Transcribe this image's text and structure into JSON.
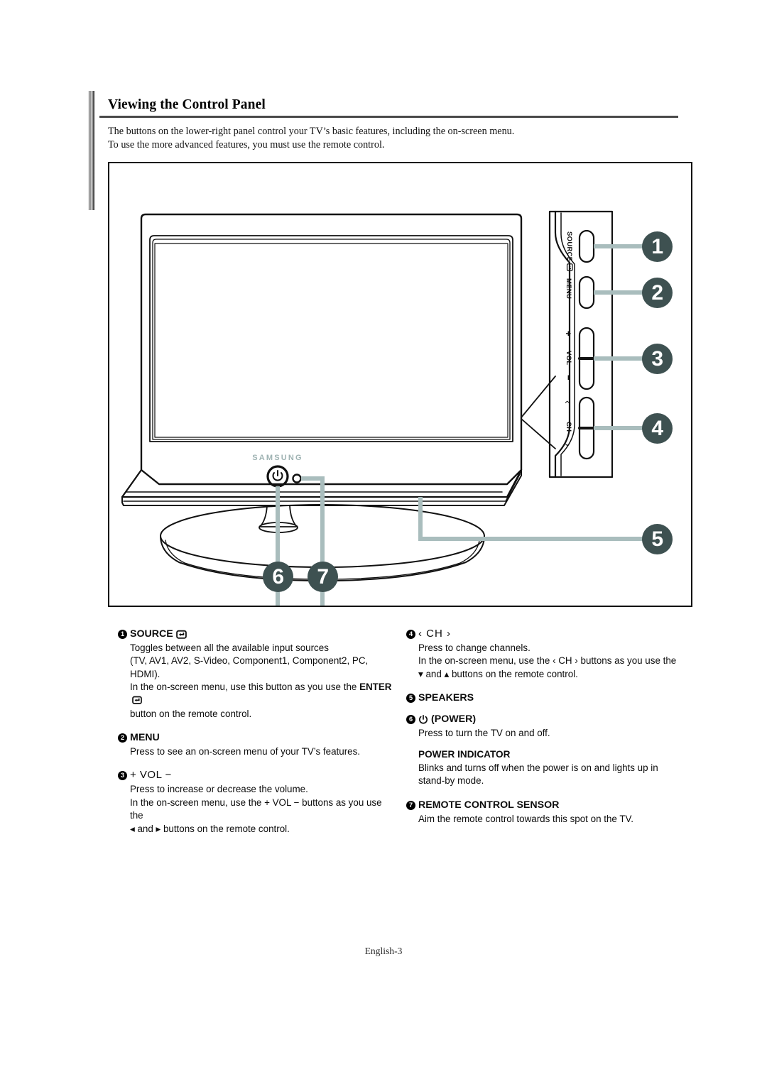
{
  "page": {
    "title": "Viewing the Control Panel",
    "intro_line1": "The buttons on the lower-right panel control your TV’s basic features, including the on-screen menu.",
    "intro_line2": "To use the more advanced features, you must use the remote control.",
    "footer": "English-3"
  },
  "colors": {
    "callout_fill": "#3e5151",
    "callout_text": "#ffffff",
    "leader_line": "#a9bdbd",
    "brand_logo": "#9fb3b3",
    "outline": "#111111"
  },
  "figure": {
    "brand_logo": "SAMSUNG",
    "callouts": [
      {
        "num": "1",
        "target": "source-button"
      },
      {
        "num": "2",
        "target": "menu-button"
      },
      {
        "num": "3",
        "target": "volume-rocker"
      },
      {
        "num": "4",
        "target": "channel-rocker"
      },
      {
        "num": "5",
        "target": "speakers"
      },
      {
        "num": "6",
        "target": "power-button"
      },
      {
        "num": "7",
        "target": "remote-control-sensor"
      }
    ],
    "panel_labels": {
      "source": "SOURCE",
      "menu": "MENU",
      "vol_plus": "+",
      "vol": "VOL",
      "vol_minus": "−",
      "ch_up": "‹",
      "ch": "CH",
      "ch_down": "›"
    }
  },
  "descriptions": {
    "left": [
      {
        "num": "1",
        "title": "SOURCE",
        "icon": "enter-icon",
        "lines": [
          "Toggles between all the available input sources",
          "(TV, AV1, AV2, S-Video, Component1, Component2, PC, HDMI).",
          "In the on-screen menu, use this button as you use the ENTER",
          "button on the remote control."
        ]
      },
      {
        "num": "2",
        "title": "MENU",
        "icon": "",
        "lines": [
          "Press to see an on-screen menu of your TV’s features."
        ]
      },
      {
        "num": "3",
        "title": "+ VOL −",
        "icon": "",
        "lines": [
          "Press to increase or decrease the volume.",
          "In the on-screen menu, use the + VOL − buttons as you use the",
          "◂ and ▸ buttons on the remote control."
        ]
      }
    ],
    "right": [
      {
        "num": "4",
        "title": "‹ CH ›",
        "icon": "",
        "lines": [
          "Press to change channels.",
          "In the on-screen menu, use the ‹ CH › buttons as you use the",
          "▾ and ▴ buttons on the remote control."
        ]
      },
      {
        "num": "5",
        "title": "SPEAKERS",
        "icon": "",
        "lines": []
      },
      {
        "num": "6",
        "title": "(POWER)",
        "icon": "power-icon",
        "lines": [
          "Press to turn the TV on and off."
        ]
      }
    ],
    "power_indicator": {
      "title": "POWER INDICATOR",
      "lines": [
        "Blinks and turns off when the power is on and lights up in",
        "stand-by mode."
      ]
    },
    "remote_sensor": {
      "num": "7",
      "title": "REMOTE CONTROL SENSOR",
      "lines": [
        "Aim the remote control towards this spot on the TV."
      ]
    },
    "inline": {
      "enter_word": "ENTER",
      "and_word": "and",
      "use_prefix": "In the on-screen menu, use the",
      "buttons_suffix": "buttons as you use the"
    }
  }
}
